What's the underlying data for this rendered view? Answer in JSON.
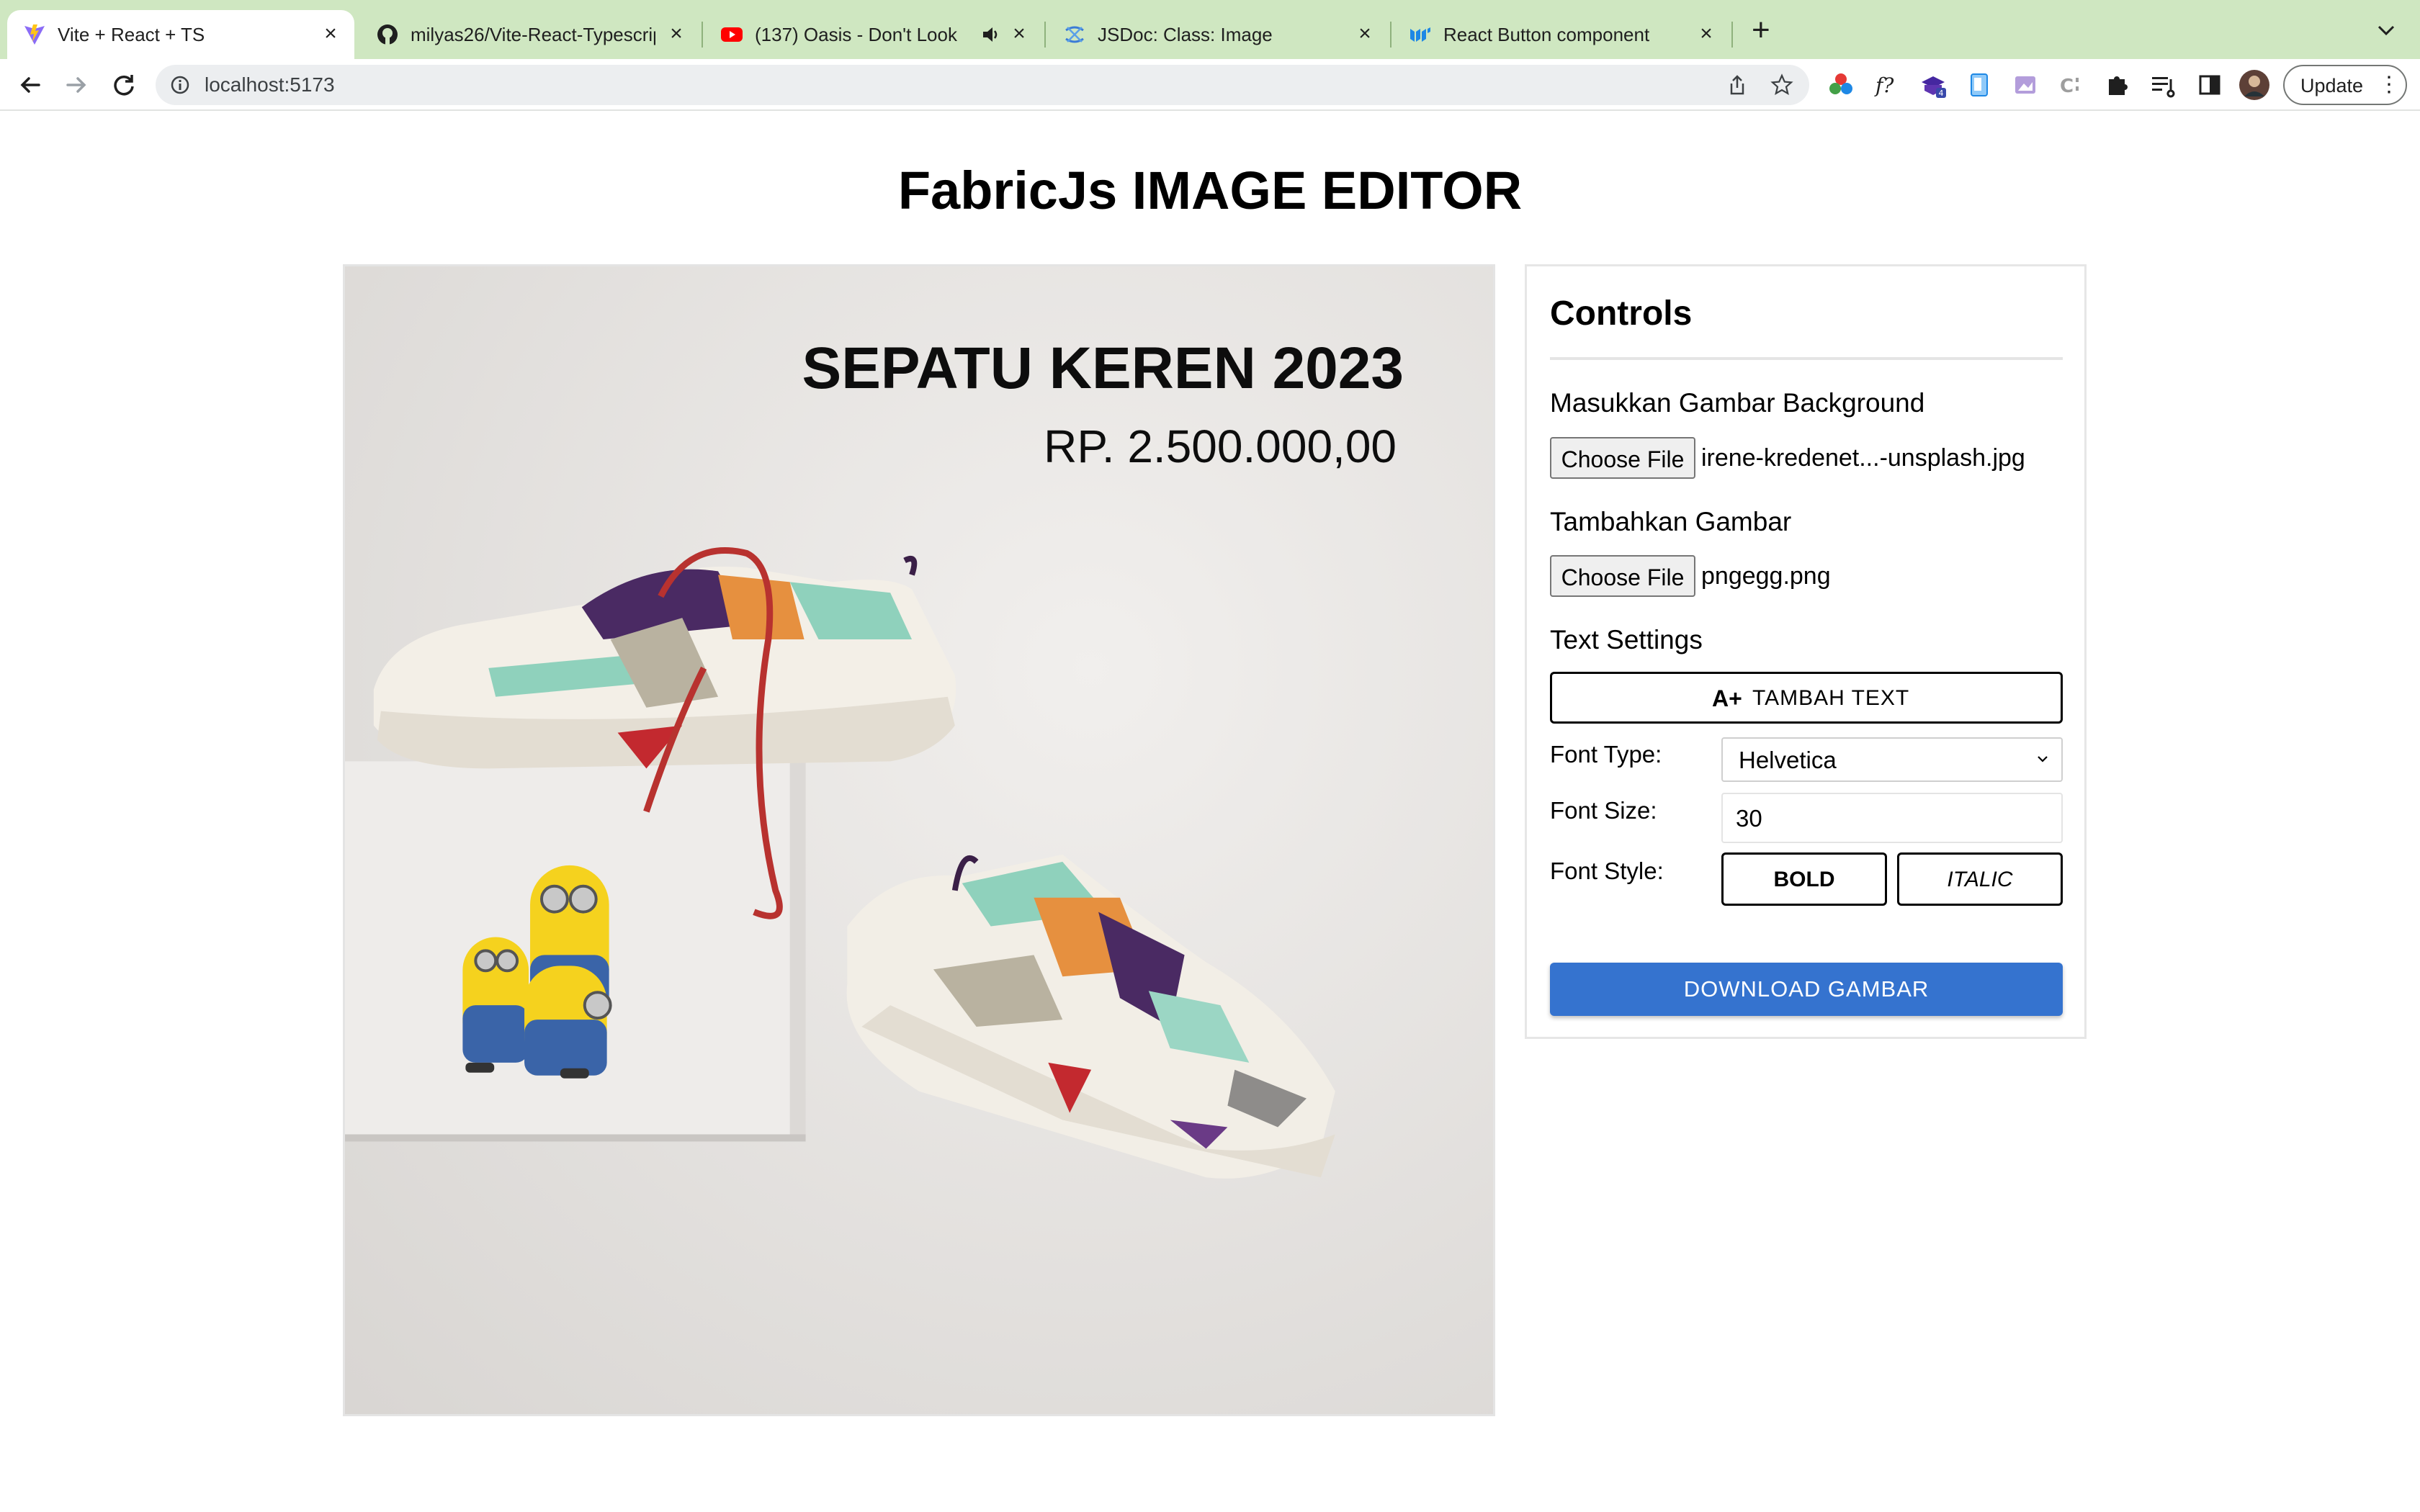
{
  "browser": {
    "tabs": [
      {
        "title": "Vite + React + TS",
        "favicon": "vite-icon",
        "active": true
      },
      {
        "title": "milyas26/Vite-React-Typescrip",
        "favicon": "github-icon",
        "active": false
      },
      {
        "title": "(137) Oasis - Don't Look B",
        "favicon": "youtube-icon",
        "active": false,
        "audio": "speaker-icon"
      },
      {
        "title": "JSDoc: Class: Image",
        "favicon": "fabric-icon",
        "active": false
      },
      {
        "title": "React Button component - Mat",
        "favicon": "mui-icon",
        "active": false
      }
    ],
    "new_tab": "+",
    "close_glyph": "×",
    "url": "localhost:5173",
    "update_label": "Update",
    "menu_glyph": "⋮",
    "colors": {
      "tabstrip": "#cfe7c1",
      "toolbar": "#ffffff",
      "omnibox": "#eceef0"
    }
  },
  "app": {
    "title": "FabricJs IMAGE EDITOR",
    "canvas": {
      "heading": "SEPATU KEREN 2023",
      "price": "RP. 2.500.000,00",
      "background_image": "sneakers-on-white-block",
      "overlay_image": "minions-group"
    },
    "controls": {
      "title": "Controls",
      "background_label": "Masukkan Gambar Background",
      "background_button": "Choose File",
      "background_file": "irene-kredenet...-unsplash.jpg",
      "image_label": "Tambahkan Gambar",
      "image_button": "Choose File",
      "image_file": "pngegg.png",
      "text_settings_label": "Text Settings",
      "add_text_icon": "A+",
      "add_text_button": "TAMBAH TEXT",
      "font_type_label": "Font Type:",
      "font_type_value": "Helvetica",
      "font_size_label": "Font Size:",
      "font_size_value": "30",
      "font_style_label": "Font Style:",
      "bold_button": "BOLD",
      "italic_button": "ITALIC",
      "download_button": "DOWNLOAD GAMBAR",
      "colors": {
        "download": "#3573cf"
      }
    }
  }
}
